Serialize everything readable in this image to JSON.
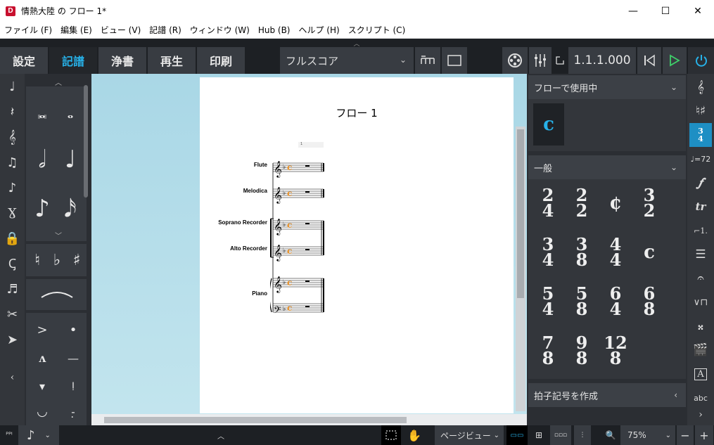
{
  "window": {
    "logo": "D",
    "title": "情熱大陸 の フロー 1*",
    "minimize": "—",
    "maximize": "☐",
    "close": "✕"
  },
  "menu": [
    "ファイル (F)",
    "編集 (E)",
    "ビュー (V)",
    "記譜 (R)",
    "ウィンドウ (W)",
    "Hub (B)",
    "ヘルプ (H)",
    "スクリプト (C)"
  ],
  "modes": [
    {
      "label": "設定",
      "active": false
    },
    {
      "label": "記譜",
      "active": true
    },
    {
      "label": "浄書",
      "active": false
    },
    {
      "label": "再生",
      "active": false
    },
    {
      "label": "印刷",
      "active": false
    }
  ],
  "toolbar": {
    "layout_value": "フルスコア",
    "position": "1.1.1.000"
  },
  "score": {
    "flow_title": "フロー 1",
    "instruments": [
      "Flute",
      "Melodica",
      "Soprano Recorder",
      "Alto Recorder",
      "Piano"
    ],
    "bar_number": "1"
  },
  "right_panel": {
    "used_header": "フローで使用中",
    "general_header": "一般",
    "create_header": "拍子記号を作成",
    "used": [
      "c"
    ],
    "signatures": [
      {
        "top": "2",
        "bottom": "4"
      },
      {
        "top": "2",
        "bottom": "2"
      },
      {
        "sym": "¢"
      },
      {
        "top": "3",
        "bottom": "2"
      },
      {
        "top": "3",
        "bottom": "4"
      },
      {
        "top": "3",
        "bottom": "8"
      },
      {
        "top": "4",
        "bottom": "4"
      },
      {
        "sym": "c"
      },
      {
        "top": "5",
        "bottom": "4"
      },
      {
        "top": "5",
        "bottom": "8"
      },
      {
        "top": "6",
        "bottom": "4"
      },
      {
        "top": "6",
        "bottom": "8"
      },
      {
        "top": "7",
        "bottom": "8"
      },
      {
        "top": "9",
        "bottom": "8"
      },
      {
        "top": "12",
        "bottom": "8"
      }
    ]
  },
  "right_strip": {
    "tempo_label": "♩=72",
    "time_active_top": "3",
    "time_active_bottom": "4",
    "text_label": "abc",
    "box_label": "A"
  },
  "statusbar": {
    "view_value": "ページビュー",
    "zoom": "75%"
  },
  "colors": {
    "accent": "#27b1e8",
    "active_strip": "#1e8fc4",
    "score_bg": "#a9d7e6",
    "play": "#3fcf6a"
  }
}
